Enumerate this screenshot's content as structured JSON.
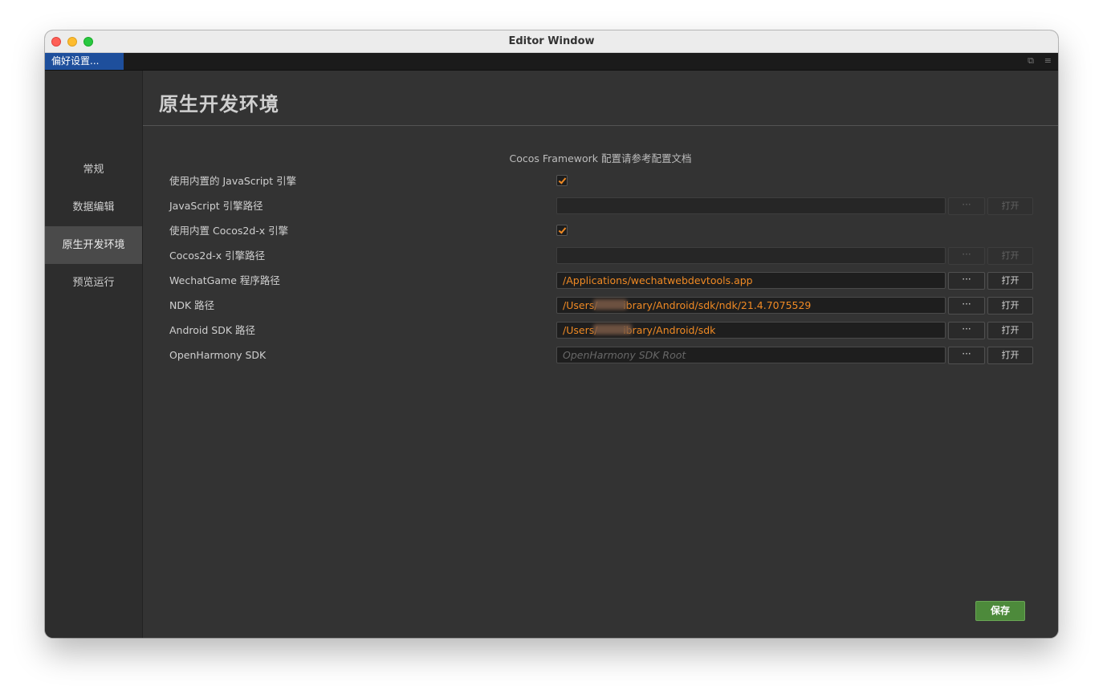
{
  "window": {
    "title": "Editor Window"
  },
  "tab": {
    "label": "偏好设置...",
    "ctrl_popout": "⧉",
    "ctrl_menu": "≡"
  },
  "sidebar": {
    "items": [
      {
        "label": "常规",
        "active": false
      },
      {
        "label": "数据编辑",
        "active": false
      },
      {
        "label": "原生开发环境",
        "active": true
      },
      {
        "label": "预览运行",
        "active": false
      }
    ]
  },
  "main": {
    "title": "原生开发环境",
    "doc_link": "Cocos Framework 配置请参考配置文档",
    "rows": [
      {
        "label": "使用内置的 JavaScript 引擎",
        "checked": true
      },
      {
        "label": "JavaScript 引擎路径",
        "value": "",
        "placeholder": "",
        "browse": "···",
        "open": "打开",
        "disabled": true
      },
      {
        "label": "使用内置 Cocos2d-x 引擎",
        "checked": true
      },
      {
        "label": "Cocos2d-x 引擎路径",
        "value": "",
        "placeholder": "",
        "browse": "···",
        "open": "打开",
        "disabled": true
      },
      {
        "label": "WechatGame 程序路径",
        "value": "/Applications/wechatwebdevtools.app",
        "placeholder": "",
        "browse": "···",
        "open": "打开",
        "disabled": false
      },
      {
        "label": "NDK 路径",
        "value": "/Users/        ibrary/Android/sdk/ndk/21.4.7075529",
        "placeholder": "",
        "browse": "···",
        "open": "打开",
        "disabled": false
      },
      {
        "label": "Android SDK 路径",
        "value": "/Users/        ibrary/Android/sdk",
        "placeholder": "",
        "browse": "···",
        "open": "打开",
        "disabled": false
      },
      {
        "label": "OpenHarmony SDK",
        "value": "",
        "placeholder": "OpenHarmony SDK Root",
        "browse": "···",
        "open": "打开",
        "disabled": false
      }
    ],
    "save_label": "保存"
  },
  "colors": {
    "accent": "#f08a24",
    "tab_active": "#1e4f9c",
    "save": "#4d8a3b"
  }
}
